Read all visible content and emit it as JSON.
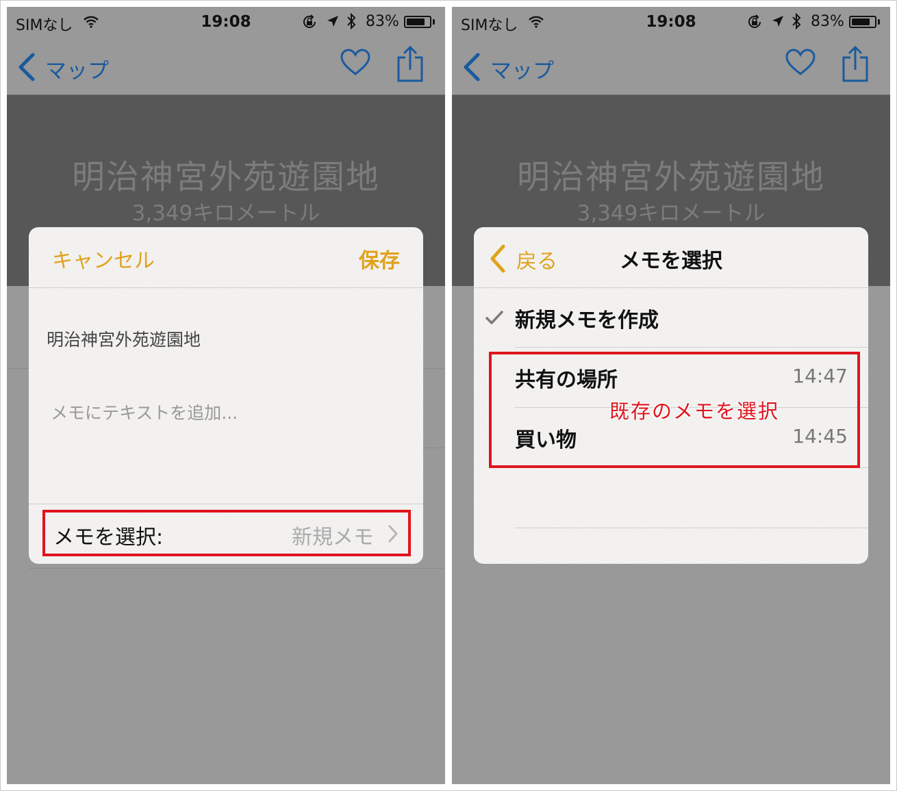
{
  "status_bar": {
    "carrier": "SIMなし",
    "time": "19:08",
    "battery": "83%",
    "battery_level": 0.83
  },
  "nav": {
    "back_label": "マップ",
    "icons": [
      "chevron-left-icon",
      "heart-icon",
      "share-icon"
    ]
  },
  "place": {
    "name": "明治神宮外苑遊園地",
    "distance": "3,349キロメートル"
  },
  "left_dialog": {
    "cancel": "キャンセル",
    "save": "保存",
    "note_title": "明治神宮外苑遊園地",
    "note_placeholder": "メモにテキストを追加...",
    "choose_label": "メモを選択:",
    "choose_value": "新規メモ"
  },
  "right_dialog": {
    "back": "戻る",
    "title": "メモを選択",
    "new_option": "新規メモを作成",
    "notes": [
      {
        "name": "共有の場所",
        "time": "14:47"
      },
      {
        "name": "買い物",
        "time": "14:45"
      }
    ],
    "annotation": "既存のメモを選択"
  },
  "colors": {
    "accent": "#e0a21c",
    "nav_blue": "#1a5a9e",
    "highlight_red": "#e0141e"
  }
}
